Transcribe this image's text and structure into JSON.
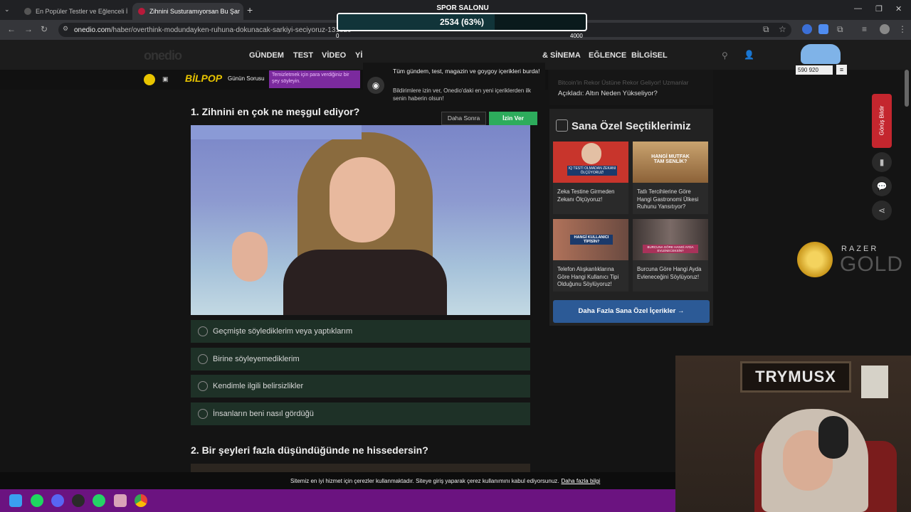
{
  "browser": {
    "tabs": [
      {
        "title": "En Popüler Testler ve Eğlenceli İ"
      },
      {
        "title": "Zihnini Susturamıyorsan Bu Şar"
      }
    ],
    "new_tab_label": "+",
    "url_domain": "onedio.com",
    "url_path": "/haber/overthink-modundayken-ruhuna-dokunacak-sarkiyi-seciyoruz-131829"
  },
  "site": {
    "logo": "onedio",
    "nav": [
      "GÜNDEM",
      "TEST",
      "VİDEO",
      "Yİ",
      "& SİNEMA",
      "EĞLENCE",
      "BİLGİSEL"
    ],
    "bilpop": "BİLPOP",
    "gunun_sorusu": "Günün Sorusu",
    "promo_text": "Temizletmek için para verdiğiniz bir şey söyleyin."
  },
  "notification": {
    "title": "Tüm gündem, test, magazin ve goygoy içerikleri burda!",
    "description": "Bildirimlere izin ver, Onedio'daki en yeni içeriklerden ilk senin haberin olsun!",
    "later_label": "Daha Sonra",
    "allow_label": "İzin Ver"
  },
  "quiz": {
    "q1_title": "1. Zihnini en çok ne meşgul ediyor?",
    "q1_options": [
      "Geçmişte söylediklerim veya yaptıklarım",
      "Birine söyleyemediklerim",
      "Kendimle ilgili belirsizlikler",
      "İnsanların beni nasıl gördüğü"
    ],
    "q2_title": "2. Bir şeyleri fazla düşündüğünde ne hissedersin?"
  },
  "sidebar": {
    "faded_headline": "Bitcoin'in Rekor Üstüne Rekor Geliyor! Uzmanlar",
    "headline": "Açıkladı: Altın Neden Yükseliyor?",
    "picks_title": "Sana Özel Seçtiklerimiz",
    "cards": [
      {
        "image_text": "IQ TESTİ OLMADAN ZEKANI ÖLÇÜYORUZ!",
        "title": "Zeka Testine Girmeden Zekanı Ölçüyoruz!",
        "image_color": "#c8352c"
      },
      {
        "image_text": "HANGİ MUTFAK TAM SENLİK?",
        "title": "Tatlı Tercihlerine Göre Hangi Gastronomi Ülkesi Ruhunu Yansıtıyor?",
        "image_color": "#b08858"
      },
      {
        "image_text": "HANGİ KULLANICI TİPİSİN?",
        "title": "Telefon Alışkanlıklarına Göre Hangi Kullanıcı Tipi Olduğunu Söylüyoruz!",
        "image_color": "#a0624a"
      },
      {
        "image_text": "BURCUNA GÖRE HANGİ AYDA EVLENECEKSİN?",
        "title": "Burcuna Göre Hangi Ayda Evleneceğini Söylüyoruz!",
        "image_color": "#5a4a48"
      }
    ],
    "more_label": "Daha Fazla Sana Özel İçerikler  →",
    "feedback_label": "Görüş Bildir"
  },
  "ad": {
    "brand": "RAZER",
    "product": "GOLD"
  },
  "stream_overlay": {
    "goal_title": "SPOR SALONU",
    "goal_text": "2534 (63%)",
    "goal_progress": 0.6335,
    "goal_min": "0",
    "goal_max": "4000",
    "viewer_count": "590 920",
    "menu_icon": "≡",
    "webcam_sign": "TRYMUSX"
  },
  "cookie": {
    "text": "Sitemiz en iyi hizmet için çerezler kullanmaktadır. Siteye giriş yaparak çerez kullanımını kabul ediyorsunuz.",
    "link": "Daha fazla bilgi"
  },
  "taskbar_icons": [
    "windows-start",
    "spotify",
    "discord",
    "steam",
    "whatsapp",
    "photos",
    "chrome"
  ],
  "colors": {
    "accent_green": "#2dac5c",
    "option_bg": "#1e3127",
    "more_button": "#2c5a96",
    "feedback_red": "#c4262e",
    "taskbar": "#6b1380"
  }
}
